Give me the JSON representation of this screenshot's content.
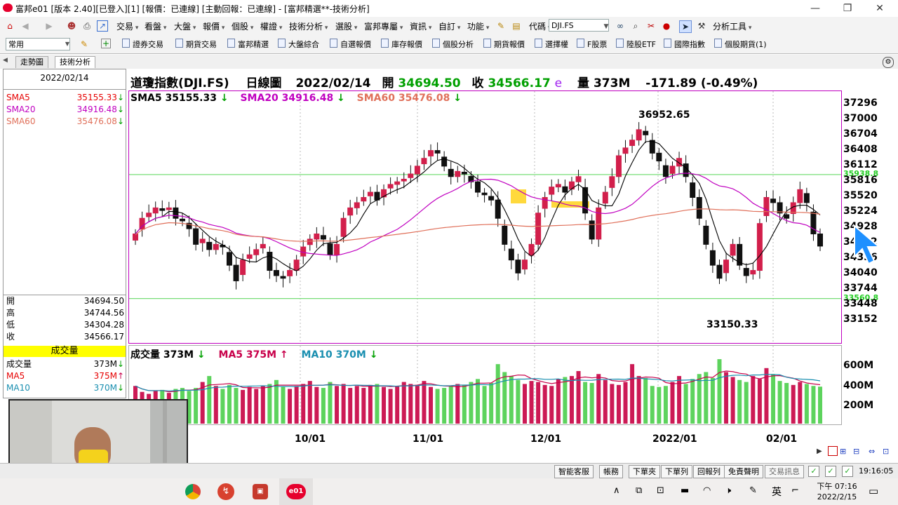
{
  "window": {
    "title": "富邦e01 [版本 2.40][已登入][1] [報價：已連線] [主動回報：已連線] - [富邦精選**-技術分析]",
    "minimize": "—",
    "restore": "❐",
    "close": "✕"
  },
  "menubar": {
    "items": [
      "交易",
      "看盤",
      "大盤",
      "報價",
      "個股",
      "權證",
      "技術分析",
      "選股",
      "富邦專屬",
      "資訊",
      "自訂",
      "功能"
    ],
    "code_label": "代碼",
    "code_value": "DJI.FS",
    "analysis_tools": "分析工具"
  },
  "quickbar": {
    "preset": "常用",
    "items": [
      "證券交易",
      "期貨交易",
      "富邦精選",
      "大盤綜合",
      "自選報價",
      "庫存報價",
      "個股分析",
      "期貨報價",
      "選擇權",
      "F股票",
      "陸股ETF",
      "國際指數",
      "個股期貨(1)"
    ]
  },
  "tabs": [
    "走勢圖",
    "技術分析"
  ],
  "left_panel": {
    "date": "2022/02/14",
    "sma": [
      {
        "label": "SMA5",
        "value": "35155.33",
        "color": "#e60000"
      },
      {
        "label": "SMA20",
        "value": "34916.48",
        "color": "#c000c0"
      },
      {
        "label": "SMA60",
        "value": "35476.08",
        "color": "#e0705a"
      }
    ],
    "ohlc": [
      {
        "label": "開",
        "value": "34694.50"
      },
      {
        "label": "高",
        "value": "34744.56"
      },
      {
        "label": "低",
        "value": "34304.28"
      },
      {
        "label": "收",
        "value": "34566.17"
      }
    ],
    "volume_header": "成交量",
    "volume": [
      {
        "label": "成交量",
        "value": "373M",
        "color": "#000000"
      },
      {
        "label": "MA5",
        "value": "375M",
        "color": "#e60000"
      },
      {
        "label": "MA10",
        "value": "370M",
        "color": "#1a8fb0"
      }
    ]
  },
  "chart_header": {
    "name": "道瓊指數(DJI.FS)",
    "period": "日線圖",
    "date": "2022/02/14",
    "open_label": "開",
    "open_value": "34694.50",
    "close_label": "收",
    "close_value": "34566.17",
    "e_flag": "e",
    "vol_label": "量",
    "vol_value": "373M",
    "change": "-171.89 (-0.49%)"
  },
  "sma_legend": [
    {
      "text": "SMA5 35155.33",
      "color": "#000000"
    },
    {
      "text": "SMA20 34916.48",
      "color": "#c000c0"
    },
    {
      "text": "SMA60 35476.08",
      "color": "#e0705a"
    }
  ],
  "vol_legend": [
    {
      "text": "成交量 373M",
      "color": "#000000",
      "arrow": "↓"
    },
    {
      "text": "MA5 375M",
      "color": "#c8004a",
      "arrow": "↑"
    },
    {
      "text": "MA10 370M",
      "color": "#1a8fb0",
      "arrow": "↓"
    }
  ],
  "chart_data": {
    "type": "candlestick",
    "y_ticks": [
      "37296",
      "37000",
      "36704",
      "36408",
      "36112",
      "35816",
      "35520",
      "35224",
      "34928",
      "34632",
      "34336",
      "34040",
      "33744",
      "33448",
      "33152"
    ],
    "ylim": [
      33000,
      37400
    ],
    "high_annotation": "36952.65",
    "low_annotation": "33150.33",
    "resistance_level": "35938.8",
    "support_level": "33560.8",
    "x_ticks": [
      "10/01",
      "11/01",
      "12/01",
      "2022/01",
      "02/01"
    ],
    "volume_ticks": [
      "600M",
      "400M",
      "200M"
    ],
    "volume_ylim": [
      0,
      700
    ],
    "series": [
      {
        "name": "SMA5",
        "color": "#000000"
      },
      {
        "name": "SMA20",
        "color": "#c000c0"
      },
      {
        "name": "SMA60",
        "color": "#e0705a"
      }
    ],
    "candles_close": [
      34800,
      35100,
      35200,
      35300,
      35250,
      35300,
      35100,
      35050,
      34900,
      34600,
      34700,
      34500,
      34600,
      34550,
      34200,
      33900,
      34300,
      34400,
      34500,
      34600,
      34100,
      34000,
      33950,
      34100,
      34300,
      34550,
      34700,
      34800,
      34700,
      34400,
      34600,
      35100,
      35300,
      35400,
      35500,
      35600,
      35450,
      35650,
      35750,
      35800,
      35850,
      35950,
      36100,
      36250,
      36400,
      36350,
      36100,
      35900,
      36000,
      35950,
      35800,
      35600,
      35550,
      35450,
      35100,
      34600,
      34300,
      34050,
      34300,
      34600,
      35200,
      35500,
      35700,
      35750,
      35600,
      35800,
      35900,
      35200,
      34700,
      35300,
      35600,
      35900,
      36300,
      36450,
      36600,
      36800,
      36700,
      36350,
      36200,
      35900,
      36100,
      36250,
      35900,
      35500,
      35100,
      34600,
      34200,
      33950,
      34300,
      34600,
      34200,
      34000,
      34100,
      35000,
      35500,
      35400,
      35200,
      35100,
      35400,
      35650,
      35400,
      34800,
      34566
    ],
    "volumes": [
      380,
      320,
      300,
      330,
      340,
      310,
      350,
      360,
      330,
      360,
      420,
      480,
      380,
      350,
      390,
      360,
      340,
      370,
      350,
      380,
      400,
      440,
      370,
      350,
      380,
      400,
      430,
      370,
      360,
      420,
      380,
      400,
      360,
      380,
      360,
      390,
      400,
      370,
      350,
      380,
      420,
      400,
      390,
      430,
      370,
      350,
      360,
      380,
      400,
      390,
      420,
      450,
      380,
      410,
      600,
      520,
      480,
      440,
      400,
      430,
      420,
      390,
      380,
      450,
      470,
      480,
      530,
      420,
      410,
      500,
      440,
      400,
      390,
      420,
      600,
      480,
      460,
      380,
      370,
      380,
      420,
      480,
      400,
      450,
      500,
      520,
      460,
      650,
      520,
      470,
      440,
      420,
      480,
      450,
      560,
      500,
      430,
      410,
      390,
      420,
      400,
      380,
      373
    ]
  },
  "status_bar": {
    "buttons": [
      "智能客服",
      "帳務",
      "下單夾",
      "下單列",
      "回報列",
      "免責聲明",
      "交易訊息"
    ],
    "time": "19:16:05"
  },
  "video": {
    "caption": "理周"
  },
  "taskbar": {
    "ime": "英",
    "clock_time": "下午 07:16",
    "clock_date": "2022/2/15"
  }
}
